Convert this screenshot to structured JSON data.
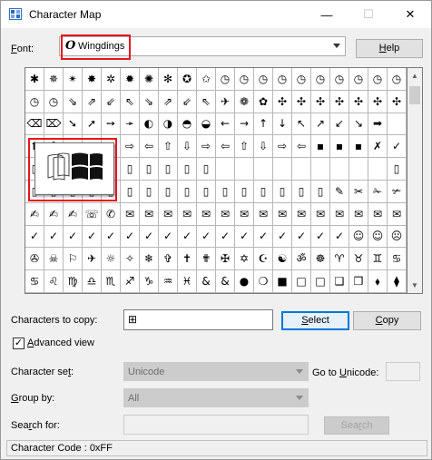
{
  "window": {
    "title": "Character Map",
    "controls": {
      "minimize": "—",
      "maximize": "☐",
      "close": "✕"
    }
  },
  "font": {
    "label_prefix": "",
    "label_u": "F",
    "label_rest": "ont:",
    "value": "Wingdings",
    "icon_glyph": "O",
    "help_u": "H",
    "help_rest": "elp"
  },
  "grid": {
    "rows": [
      [
        "✱",
        "✵",
        "✴",
        "✸",
        "✲",
        "✹",
        "✺",
        "✻",
        "✪",
        "✩",
        "◷",
        "◷",
        "◷",
        "◷",
        "◷",
        "◷",
        "◷",
        "◷",
        "◷",
        "◷"
      ],
      [
        "◷",
        "◷",
        "⇘",
        "⇗",
        "⇙",
        "⇖",
        "⇘",
        "⇗",
        "⇙",
        "⇖",
        "✈",
        "❁",
        "✿",
        "✣",
        "✣",
        "✣",
        "✣",
        "✣",
        "✣",
        "✣"
      ],
      [
        "⌫",
        "⌦",
        "➘",
        "➚",
        "➙",
        "➛",
        "◐",
        "◑",
        "◓",
        "◒",
        "←",
        "→",
        "↑",
        "↓",
        "↖",
        "↗",
        "↙",
        "↘",
        "➡",
        ""
      ],
      [
        "⬆",
        "⬇",
        "↘",
        "↖",
        "➞",
        "⇨",
        "⇦",
        "⇧",
        "⇩",
        "⇨",
        "⇦",
        "⇧",
        "⇩",
        "⇨",
        "⇦",
        "▪",
        "▪",
        "▪",
        "✗",
        "✓"
      ],
      [
        "▯",
        "▯",
        "▯",
        "▯",
        "▯",
        "▯",
        "▯",
        "▯",
        "▯",
        "▯",
        "",
        "",
        "",
        "",
        "",
        "",
        "",
        "",
        "",
        "▯"
      ],
      [
        "▯",
        "▯",
        "▯",
        "▯",
        "▯",
        "▯",
        "▯",
        "▯",
        "▯",
        "▯",
        "▯",
        "▯",
        "▯",
        "▯",
        "▯",
        "▯",
        "✎",
        "✂",
        "✁",
        "✃"
      ],
      [
        "✍",
        "✍",
        "✍",
        "☏",
        "✆",
        "✉",
        "✉",
        "✉",
        "✉",
        "✉",
        "✉",
        "✉",
        "✉",
        "✉",
        "✉",
        "✉",
        "✉",
        "✉",
        "✉",
        "✉"
      ],
      [
        "✓",
        "✓",
        "✓",
        "✓",
        "✓",
        "✓",
        "✓",
        "✓",
        "✓",
        "✓",
        "✓",
        "✓",
        "✓",
        "✓",
        "✓",
        "✓",
        "✓",
        "☺",
        "☺",
        "☹"
      ],
      [
        "✇",
        "☠",
        "⚐",
        "✈",
        "☼",
        "✧",
        "❄",
        "✞",
        "✝",
        "✟",
        "✠",
        "✡",
        "☪",
        "☯",
        "ॐ",
        "☸",
        "♈",
        "♉",
        "♊",
        "♋"
      ],
      [
        "♋",
        "♌",
        "♍",
        "♎",
        "♏",
        "♐",
        "♑",
        "♒",
        "♓",
        "&",
        "&",
        "●",
        "❍",
        "■",
        "□",
        "□",
        "❑",
        "❒",
        "⬧",
        "⧫"
      ]
    ]
  },
  "controls": {
    "chars_to_copy_label": "Characters to copy:",
    "chars_to_copy_value": "⊞",
    "select_u": "S",
    "select_rest": "elect",
    "copy_u": "C",
    "copy_rest": "opy",
    "advanced_label_u": "A",
    "advanced_label_rest": "dvanced view",
    "advanced_checked": "✓",
    "charset_label_pre": "Character se",
    "charset_label_u": "t",
    "charset_label_post": ":",
    "charset_value": "Unicode",
    "goto_label_pre": "Go to ",
    "goto_label_u": "U",
    "goto_label_post": "nicode:",
    "groupby_label_pre": "",
    "groupby_label_u": "G",
    "groupby_label_post": "roup by:",
    "groupby_value": "All",
    "search_label_pre": "Sea",
    "search_label_u": "r",
    "search_label_post": "ch for:",
    "search_button_pre": "Sea",
    "search_button_u": "r",
    "search_button_post": "ch"
  },
  "status": {
    "text": "Character Code : 0xFF"
  },
  "colors": {
    "highlight_box": "#e8141c",
    "select_border": "#0078d7"
  }
}
